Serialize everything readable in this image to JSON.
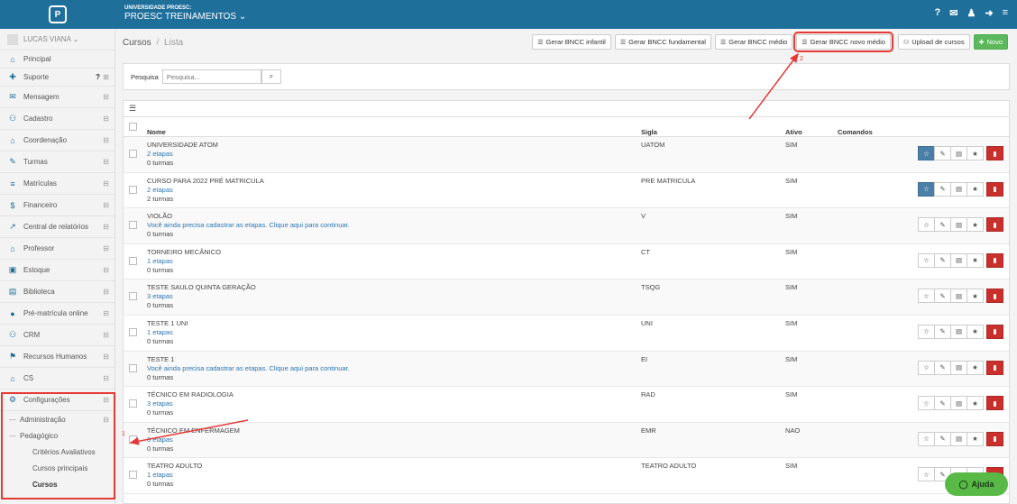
{
  "header": {
    "university": "UNIVERSIDADE PROESC:",
    "company": "PROESC TREINAMENTOS ⌄",
    "icons": [
      "help-icon",
      "mail-icon",
      "user-icon",
      "logout-icon",
      "menu-icon"
    ],
    "icon_glyphs": [
      "?",
      "✉",
      "♟",
      "➜",
      "≡"
    ]
  },
  "sidebar": {
    "user": "LUCAS VIANA ⌄",
    "items": [
      {
        "label": "Principal",
        "icon": "home-icon",
        "glyph": "⌂"
      },
      {
        "label": "Suporte",
        "icon": "support-icon",
        "glyph": "✚"
      },
      {
        "label": "Mensagem",
        "icon": "envelope-icon",
        "glyph": "✉"
      },
      {
        "label": "Cadastro",
        "icon": "users-icon",
        "glyph": "⚇"
      },
      {
        "label": "Coordenação",
        "icon": "graduation-icon",
        "glyph": "⌂"
      },
      {
        "label": "Turmas",
        "icon": "pencil-icon",
        "glyph": "✎"
      },
      {
        "label": "Matrículas",
        "icon": "book-icon",
        "glyph": "≡"
      },
      {
        "label": "Financeiro",
        "icon": "money-icon",
        "glyph": "$"
      },
      {
        "label": "Central de relatórios",
        "icon": "chart-icon",
        "glyph": "↗"
      },
      {
        "label": "Professor",
        "icon": "teacher-icon",
        "glyph": "⌂"
      },
      {
        "label": "Estoque",
        "icon": "box-icon",
        "glyph": "▣"
      },
      {
        "label": "Biblioteca",
        "icon": "library-icon",
        "glyph": "▤"
      },
      {
        "label": "Pré-matrícula online",
        "icon": "globe-icon",
        "glyph": "●"
      },
      {
        "label": "CRM",
        "icon": "crm-icon",
        "glyph": "⚇"
      },
      {
        "label": "Recursos Humanos",
        "icon": "flag-icon",
        "glyph": "⚑"
      },
      {
        "label": "CS",
        "icon": "cs-icon",
        "glyph": "⌂"
      },
      {
        "label": "Configurações",
        "icon": "cogs-icon",
        "glyph": "⚙"
      }
    ],
    "sub_admin": "Administração",
    "sub_ped": "Pedagógico",
    "subsub": [
      "Critérios Avaliativos",
      "Cursos principais",
      "Cursos"
    ]
  },
  "breadcrumb": {
    "section": "Cursos",
    "sep": "/",
    "current": "Lista"
  },
  "toolbar": {
    "buttons": [
      "Gerar BNCC infantil",
      "Gerar BNCC fundamental",
      "Gerar BNCC médio",
      "Gerar BNCC novo médio",
      "Upload de cursos",
      "Novo"
    ]
  },
  "search": {
    "label": "Pesquisa",
    "placeholder": "Pesquisa..."
  },
  "table": {
    "headers": [
      "Nome",
      "Sigla",
      "Ativo",
      "Comandos"
    ],
    "rows": [
      {
        "nome": "UNIVERSIDADE ATOM",
        "etapas": "2 etapas",
        "turmas": "0 turmas",
        "sigla": "UATOM",
        "ativo": "SIM",
        "starred": true
      },
      {
        "nome": "CURSO PARA 2022 PRÉ MATRICULA",
        "etapas": "2 etapas",
        "turmas": "2 turmas",
        "sigla": "PRE MATRICULA",
        "ativo": "SIM",
        "starred": true
      },
      {
        "nome": "VIOLÃO",
        "etapas": "Você ainda precisa cadastrar as etapas. Clique aqui para continuar.",
        "turmas": "0 turmas",
        "sigla": "V",
        "ativo": "SIM",
        "starred": false
      },
      {
        "nome": "TORNEIRO MECÂNICO",
        "etapas": "1 etapas",
        "turmas": "0 turmas",
        "sigla": "CT",
        "ativo": "SIM",
        "starred": false
      },
      {
        "nome": "TESTE SAULO QUINTA GERAÇÃO",
        "etapas": "3 etapas",
        "turmas": "0 turmas",
        "sigla": "TSQG",
        "ativo": "SIM",
        "starred": false
      },
      {
        "nome": "TESTE 1 UNI",
        "etapas": "1 etapas",
        "turmas": "0 turmas",
        "sigla": "UNI",
        "ativo": "SIM",
        "starred": false
      },
      {
        "nome": "TESTE 1",
        "etapas": "Você ainda precisa cadastrar as etapas. Clique aqui para continuar.",
        "turmas": "0 turmas",
        "sigla": "EI",
        "ativo": "SIM",
        "starred": false
      },
      {
        "nome": "TÉCNICO EM RADIOLOGIA",
        "etapas": "3 etapas",
        "turmas": "0 turmas",
        "sigla": "RAD",
        "ativo": "SIM",
        "starred": false
      },
      {
        "nome": "TÉCNICO EM ENFERMAGEM",
        "etapas": "3 etapas",
        "turmas": "0 turmas",
        "sigla": "EMR",
        "ativo": "NAO",
        "starred": false
      },
      {
        "nome": "TEATRO ADULTO",
        "etapas": "1 etapas",
        "turmas": "0 turmas",
        "sigla": "TEATRO ADULTO",
        "ativo": "SIM",
        "starred": false
      }
    ]
  },
  "annotations": {
    "one": "1",
    "two": "2"
  },
  "help": {
    "label": "Ajuda"
  },
  "colors": {
    "topbar": "#1f6f9b",
    "highlight": "#e53935",
    "new_button": "#5cb85c",
    "delete_button": "#c9302c",
    "star_active": "#4a7fa8"
  }
}
